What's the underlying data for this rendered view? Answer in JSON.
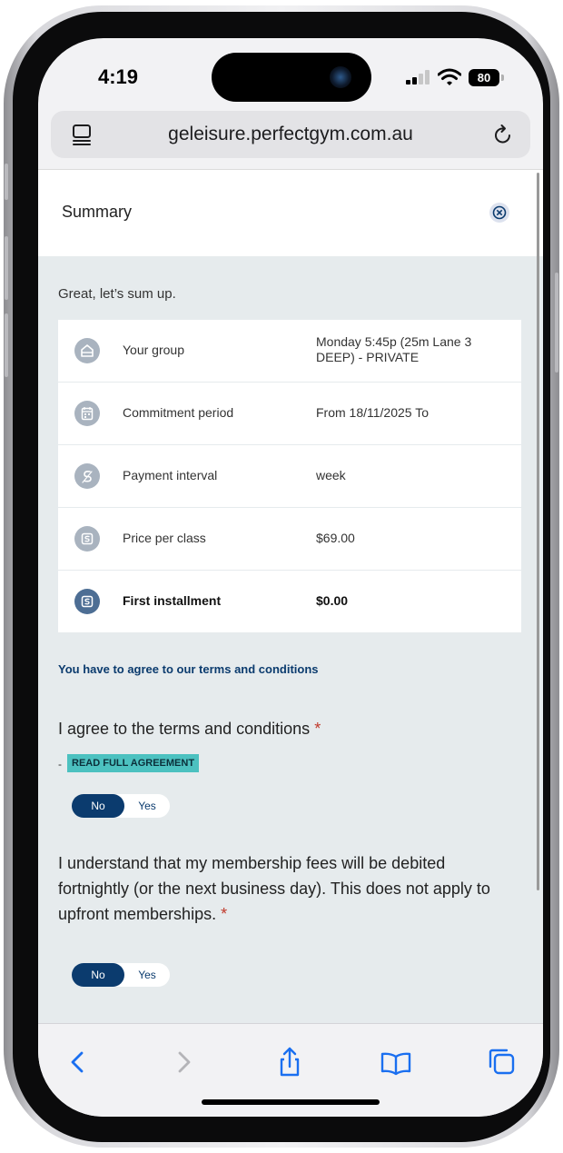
{
  "status_bar": {
    "time": "4:19",
    "battery": "80"
  },
  "browser": {
    "url": "geleisure.perfectgym.com.au"
  },
  "summary": {
    "title": "Summary",
    "intro": "Great, let’s sum up.",
    "rows": [
      {
        "label": "Your group",
        "value": "Monday 5:45p (25m Lane 3 DEEP) - PRIVATE",
        "icon": "home-icon"
      },
      {
        "label": "Commitment period",
        "value": "From 18/11/2025 To",
        "icon": "calendar-icon"
      },
      {
        "label": "Payment interval",
        "value": "week",
        "icon": "payment-icon"
      },
      {
        "label": "Price per class",
        "value": "$69.00",
        "icon": "dollar-icon"
      },
      {
        "label": "First installment",
        "value": "$0.00",
        "icon": "dollar-icon"
      }
    ]
  },
  "terms": {
    "notice": "You have to agree to our terms and conditions",
    "q1": "I agree to the terms and conditions",
    "required_mark": "*",
    "dash": "-",
    "read_link": "READ FULL AGREEMENT",
    "q2": "I understand that my membership fees will be debited fortnightly (or the next business day). This does not apply to upfront memberships.",
    "no_label": "No",
    "yes_label": "Yes"
  },
  "colors": {
    "accent": "#0b3b6e",
    "link_bg": "#4cc1c0",
    "required": "#c0392b",
    "page_bg": "#e6ebed"
  },
  "toolbar": {
    "icons": [
      "back-icon",
      "forward-icon",
      "share-icon",
      "bookmarks-icon",
      "tabs-icon"
    ]
  }
}
